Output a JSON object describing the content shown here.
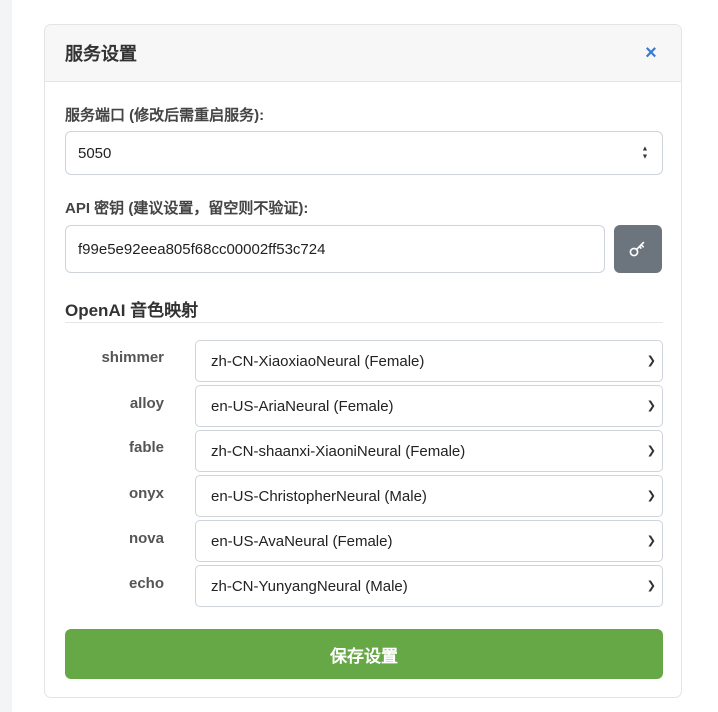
{
  "dialog": {
    "title": "服务设置",
    "close_glyph": "×"
  },
  "port": {
    "label": "服务端口 (修改后需重启服务):",
    "value": "5050"
  },
  "api_key": {
    "label": "API 密钥 (建议设置，留空则不验证):",
    "value": "f99e5e92eea805f68cc00002ff53c724"
  },
  "voice_mapping": {
    "title": "OpenAI 音色映射",
    "rows": [
      {
        "name": "shimmer",
        "voice": "zh-CN-XiaoxiaoNeural (Female)"
      },
      {
        "name": "alloy",
        "voice": "en-US-AriaNeural (Female)"
      },
      {
        "name": "fable",
        "voice": "zh-CN-shaanxi-XiaoniNeural (Female)"
      },
      {
        "name": "onyx",
        "voice": "en-US-ChristopherNeural (Male)"
      },
      {
        "name": "nova",
        "voice": "en-US-AvaNeural (Female)"
      },
      {
        "name": "echo",
        "voice": "zh-CN-YunyangNeural (Male)"
      }
    ]
  },
  "save_button": {
    "label": "保存设置"
  },
  "colors": {
    "accent_blue": "#3a7bd5",
    "save_green": "#67a846",
    "key_button_gray": "#6c757d"
  },
  "icons": {
    "close": "close-icon",
    "key": "key-icon",
    "stepper": "stepper-icon",
    "select_chevron": "chevron-down-icon"
  }
}
